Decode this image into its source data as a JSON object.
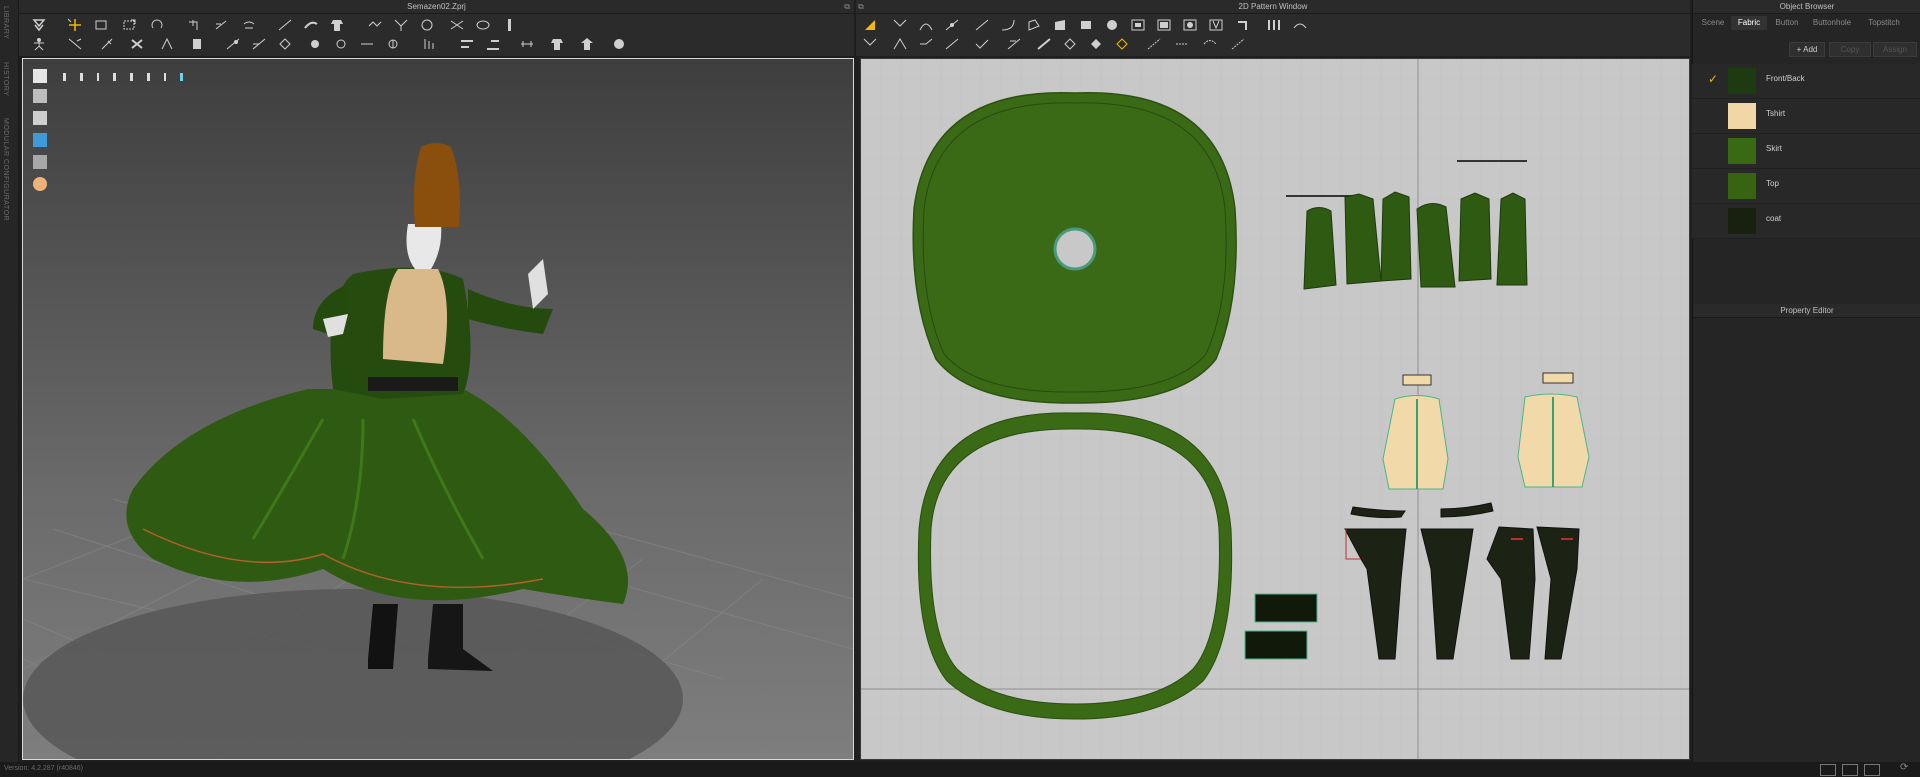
{
  "left_strip": {
    "labels": [
      "LIBRARY",
      "HISTORY",
      "MODULAR CONFIGURATOR"
    ]
  },
  "viewport3d": {
    "title": "Semazen02.Zprj"
  },
  "pattern2d": {
    "title": "2D Pattern Window"
  },
  "object_browser": {
    "title": "Object Browser",
    "tabs": [
      "Scene",
      "Fabric",
      "Button",
      "Buttonhole",
      "Topstitch"
    ],
    "active_tab": "Fabric",
    "add_label": "+ Add",
    "copy_label": "Copy",
    "assign_label": "Assign",
    "fabrics": [
      {
        "name": "Front/Back",
        "color": "#1e3a10",
        "checked": true
      },
      {
        "name": "Tshirt",
        "color": "#f2d7a6",
        "checked": false
      },
      {
        "name": "Skirt",
        "color": "#3a6914",
        "checked": false
      },
      {
        "name": "Top",
        "color": "#386411",
        "checked": false
      },
      {
        "name": "coat",
        "color": "#18200f",
        "checked": false
      }
    ]
  },
  "property_editor": {
    "title": "Property Editor"
  },
  "status": {
    "version": "Version: 4.2.287 (r40846)"
  },
  "colors": {
    "fabric_green": "#3b6a16",
    "fabric_dark": "#1d2314",
    "tshirt": "#f1d9aa",
    "accent": "#f5b800"
  }
}
